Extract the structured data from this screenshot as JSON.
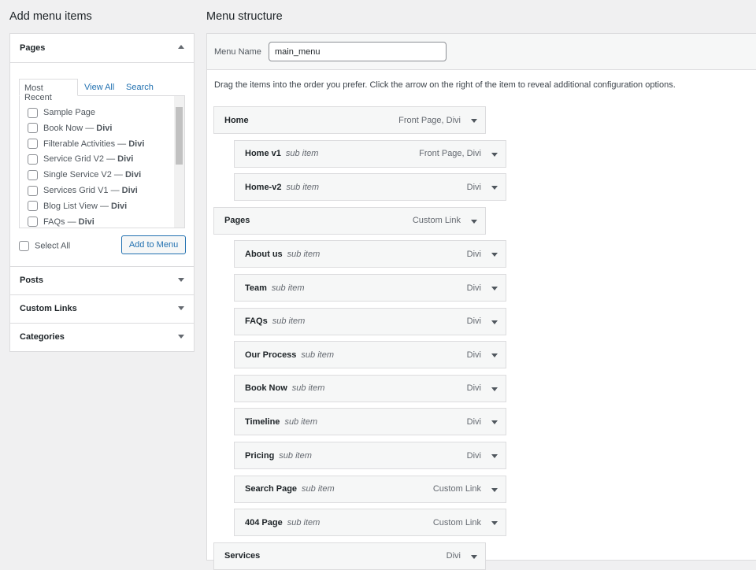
{
  "left": {
    "title": "Add menu items",
    "pages": {
      "title": "Pages",
      "tabs": [
        "Most Recent",
        "View All",
        "Search"
      ],
      "items": [
        {
          "name": "Sample Page",
          "suffix": ""
        },
        {
          "name": "Book Now",
          "suffix": "Divi"
        },
        {
          "name": "Filterable Activities",
          "suffix": "Divi"
        },
        {
          "name": "Service Grid V2",
          "suffix": "Divi"
        },
        {
          "name": "Single Service V2",
          "suffix": "Divi"
        },
        {
          "name": "Services Grid V1",
          "suffix": "Divi"
        },
        {
          "name": "Blog List View",
          "suffix": "Divi"
        },
        {
          "name": "FAQs",
          "suffix": "Divi"
        }
      ],
      "select_all": "Select All",
      "add_button": "Add to Menu"
    },
    "sections": [
      "Posts",
      "Custom Links",
      "Categories"
    ]
  },
  "right": {
    "title": "Menu structure",
    "menu_name_label": "Menu Name",
    "menu_name_value": "main_menu",
    "instructions": "Drag the items into the order you prefer. Click the arrow on the right of the item to reveal additional configuration options.",
    "items": [
      {
        "title": "Home",
        "sub": "",
        "type": "Front Page, Divi",
        "level": 0
      },
      {
        "title": "Home v1",
        "sub": "sub item",
        "type": "Front Page, Divi",
        "level": 1
      },
      {
        "title": "Home-v2",
        "sub": "sub item",
        "type": "Divi",
        "level": 1
      },
      {
        "title": "Pages",
        "sub": "",
        "type": "Custom Link",
        "level": 0
      },
      {
        "title": "About us",
        "sub": "sub item",
        "type": "Divi",
        "level": 1
      },
      {
        "title": "Team",
        "sub": "sub item",
        "type": "Divi",
        "level": 1
      },
      {
        "title": "FAQs",
        "sub": "sub item",
        "type": "Divi",
        "level": 1
      },
      {
        "title": "Our Process",
        "sub": "sub item",
        "type": "Divi",
        "level": 1
      },
      {
        "title": "Book Now",
        "sub": "sub item",
        "type": "Divi",
        "level": 1
      },
      {
        "title": "Timeline",
        "sub": "sub item",
        "type": "Divi",
        "level": 1
      },
      {
        "title": "Pricing",
        "sub": "sub item",
        "type": "Divi",
        "level": 1
      },
      {
        "title": "Search Page",
        "sub": "sub item",
        "type": "Custom Link",
        "level": 1
      },
      {
        "title": "404 Page",
        "sub": "sub item",
        "type": "Custom Link",
        "level": 1
      },
      {
        "title": "Services",
        "sub": "",
        "type": "Divi",
        "level": 0
      }
    ]
  }
}
